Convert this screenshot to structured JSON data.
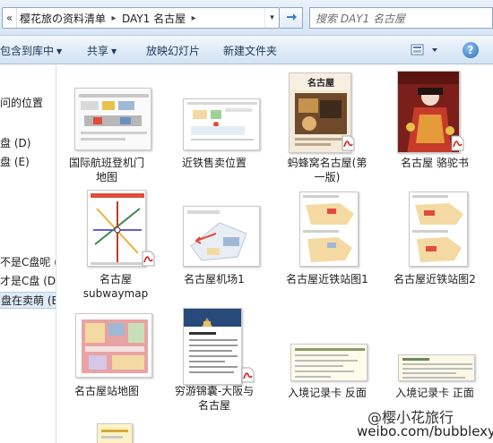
{
  "address": {
    "overflow_label": "«",
    "crumbs": [
      "樱花旅の资料清单",
      "DAY1 名古屋"
    ],
    "separator": "▸",
    "dropdown": "▾"
  },
  "search": {
    "placeholder": "搜索 DAY1 名古屋"
  },
  "toolbar": {
    "include_library": "包含到库中",
    "share": "共享",
    "slideshow": "放映幻灯片",
    "new_folder": "新建文件夹",
    "help": "?"
  },
  "nav": {
    "items": [
      "问的位置",
      "盘 (D)",
      "盘 (E)",
      "不是C盘呢 (",
      "才是C盘 (D:)",
      "盘在卖萌 (E:)"
    ]
  },
  "files": [
    {
      "name": "国际航班登机门\n地图",
      "icon": "map-thumbnail"
    },
    {
      "name": "近铁售卖位置",
      "icon": "map-thumbnail"
    },
    {
      "name": "蚂蜂窝名古屋(第\n一版)",
      "icon": "pdf-cover"
    },
    {
      "name": "名古屋 骆驼书",
      "icon": "pdf-cover"
    },
    {
      "name": "名古屋\nsubwaymap",
      "icon": "pdf-map"
    },
    {
      "name": "名古屋机场1",
      "icon": "map-thumbnail"
    },
    {
      "name": "名古屋近铁站图1",
      "icon": "map-thumbnail"
    },
    {
      "name": "名古屋近铁站图2",
      "icon": "map-thumbnail"
    },
    {
      "name": "名古屋站地图",
      "icon": "map-thumbnail"
    },
    {
      "name": "穷游锦囊-大阪与\n名古屋",
      "icon": "pdf-cover"
    },
    {
      "name": "入境记录卡 反面",
      "icon": "card-thumbnail"
    },
    {
      "name": "入境记录卡 正面",
      "icon": "card-thumbnail"
    }
  ],
  "watermark": {
    "line1": "@樱小花旅行",
    "line2": "weibo.com/bubblexyd"
  },
  "colors": {
    "accent": "#1e395b",
    "pdf_red": "#d7261e"
  }
}
